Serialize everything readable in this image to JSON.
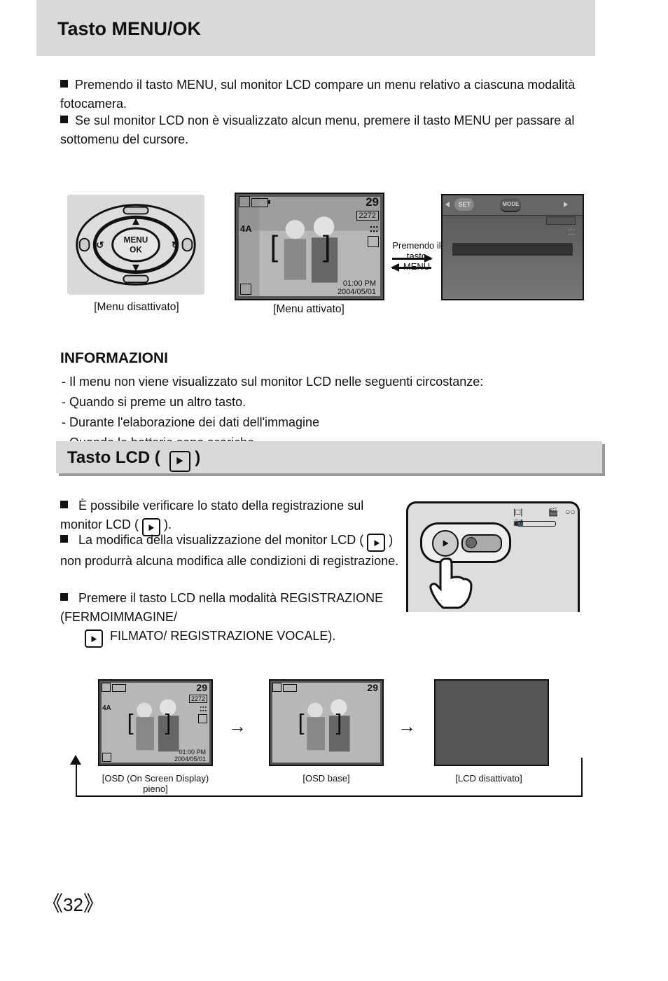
{
  "page_number": "32",
  "title": "Tasto MENU/OK",
  "bullets_top": {
    "b1": "Premendo il tasto MENU, sul monitor LCD compare un menu relativo a ciascuna modalità fotocamera.",
    "b2": "Se sul monitor LCD non è visualizzato alcun menu, premere il tasto MENU per passare al sottomenu del cursore."
  },
  "figrow1": {
    "menu_label": "MENU",
    "ok_label": "OK",
    "preview_29": "29",
    "preview_2272": "2272",
    "flash_label": "4A",
    "time": "01:00 PM",
    "date": "2004/05/01",
    "menubar": {
      "set": "SET",
      "mode": "MODE"
    },
    "arrow1": "Premendo il tasto MENU",
    "caption_left": "[Menu disattivato]",
    "caption_mid": "[Menu attivato]",
    "caption_right_a": "[Menu disattivato]",
    "caption_right_b": "Premendo il tasto MENU"
  },
  "info": {
    "header": "INFORMAZIONI",
    "l1": "- Il menu non viene visualizzato sul monitor LCD nelle seguenti circostanze:",
    "l2": "- Quando si preme un altro tasto.",
    "l3": "- Durante l'elaborazione dei dati dell'immagine",
    "l4": "- Quando le batterie sono scariche."
  },
  "section2": {
    "title": "Tasto LCD (          )",
    "b1": "È possibile verificare lo stato della registrazione sul monitor LCD (          ).",
    "b2": "La modifica della visualizzazione del monitor LCD (          ) non produrrà alcuna modifica alle condizioni di registrazione.",
    "b3": "Premere il tasto LCD nella modalità REGISTRAZIONE (FERMOIMMAGINE/ FILMATO/ REGISTRAZIONE VOCALE) (          )."
  },
  "cam_icons": {
    "disp": "|□|",
    "movie": "⧉",
    "voice": "○○",
    "still": "◉"
  },
  "lcdrow": {
    "num29": "29",
    "box2272": "2272",
    "flash": "4A",
    "time": "01:00 PM",
    "date": "2004/05/01",
    "cap1": "[OSD (On Screen Display) pieno]",
    "cap2": "[OSD base]",
    "cap3": "[LCD disattivato]"
  }
}
